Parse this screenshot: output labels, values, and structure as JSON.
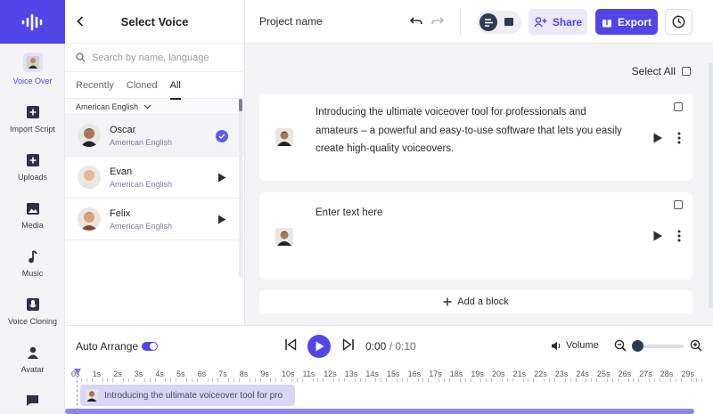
{
  "rail": {
    "items": [
      {
        "label": "Voice Over"
      },
      {
        "label": "Import Script"
      },
      {
        "label": "Uploads"
      },
      {
        "label": "Media"
      },
      {
        "label": "Music"
      },
      {
        "label": "Voice Cloning"
      },
      {
        "label": "Avatar"
      }
    ]
  },
  "voice_panel": {
    "title": "Select Voice",
    "search_placeholder": "Search by name, language",
    "tabs": [
      "Recently",
      "Cloned",
      "All"
    ],
    "active_tab": "All",
    "filter": "American English",
    "voices": [
      {
        "name": "Oscar",
        "lang": "American English",
        "selected": true
      },
      {
        "name": "Evan",
        "lang": "American English",
        "selected": false
      },
      {
        "name": "Felix",
        "lang": "American English",
        "selected": false
      }
    ]
  },
  "topbar": {
    "project_name": "Project name",
    "share_label": "Share",
    "export_label": "Export"
  },
  "editor": {
    "select_all_label": "Select All",
    "blocks": [
      {
        "text": "Introducing the ultimate voiceover tool for professionals and amateurs – a powerful and easy-to-use software that lets you easily create high-quality voiceovers."
      },
      {
        "text": "Enter text here"
      }
    ],
    "add_block_label": "Add a block"
  },
  "transport": {
    "auto_arrange_label": "Auto Arrange",
    "auto_arrange_on": true,
    "current_time": "0:00",
    "total_time": "/ 0:10",
    "volume_label": "Volume"
  },
  "timeline": {
    "ticks": [
      "0s",
      "1s",
      "2s",
      "3s",
      "4s",
      "5s",
      "6s",
      "7s",
      "8s",
      "9s",
      "10s",
      "11s",
      "12s",
      "13s",
      "14s",
      "15s",
      "16s",
      "17s",
      "18s",
      "19s",
      "20s",
      "21s",
      "22s",
      "23s",
      "24s",
      "25s",
      "26s",
      "27s",
      "28s",
      "29s"
    ],
    "clip_text": "Introducing the ultimate voiceover tool for pro"
  },
  "colors": {
    "accent": "#5145e8",
    "accent_light": "#ebeaf9",
    "clip": "#d9d6f8"
  }
}
